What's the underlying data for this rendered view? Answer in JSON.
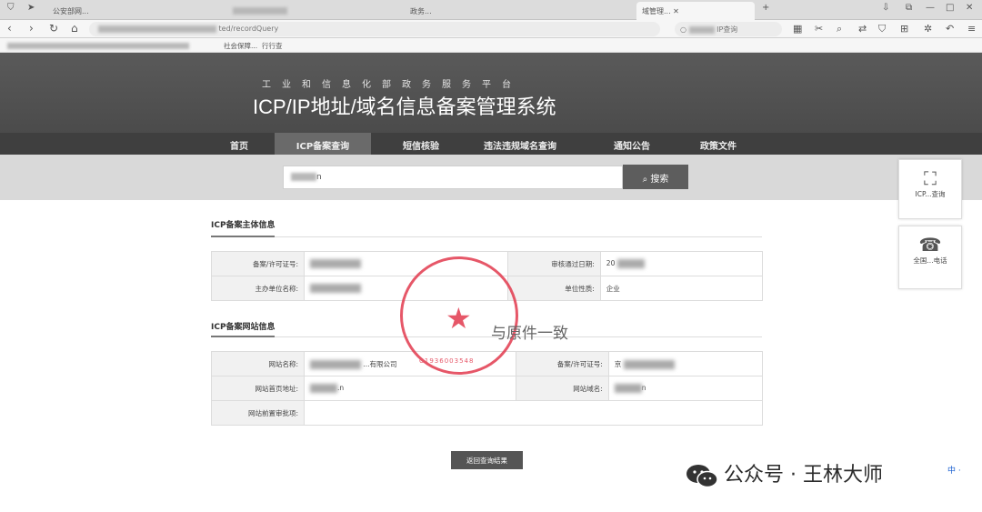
{
  "browser": {
    "tabs": [
      {
        "label": "公安部网..."
      },
      {
        "label": ""
      },
      {
        "label": "政务..."
      },
      {
        "label": "域管理..."
      }
    ],
    "url": "ted/recordQuery",
    "search_placeholder": "IP查询",
    "bookmarks": [
      "社会保障...",
      "行行查"
    ],
    "window_controls": [
      "⧉",
      "—",
      "□",
      "✕"
    ]
  },
  "site": {
    "subtitle": "工业和信息化部政务服务平台",
    "title": "ICP/IP地址/域名信息备案管理系统",
    "nav": [
      {
        "label": "首页",
        "active": false
      },
      {
        "label": "ICP备案查询",
        "active": true
      },
      {
        "label": "短信核验",
        "active": false
      },
      {
        "label": "违法违规域名查询",
        "active": false
      },
      {
        "label": "通知公告",
        "active": false
      },
      {
        "label": "政策文件",
        "active": false
      }
    ],
    "search": {
      "value": "n",
      "button": "搜索"
    }
  },
  "subject": {
    "title": "ICP备案主体信息",
    "rows": [
      {
        "label1": "备案/许可证号:",
        "value1": "",
        "label2": "审核通过日期:",
        "value2": "20"
      },
      {
        "label1": "主办单位名称:",
        "value1": "",
        "label2": "单位性质:",
        "value2": "企业"
      }
    ]
  },
  "website": {
    "title": "ICP备案网站信息",
    "rows": [
      {
        "label1": "网站名称:",
        "value1": "...有限公司",
        "label2": "备案/许可证号:",
        "value2": "京"
      },
      {
        "label1": "网站首页地址:",
        "value1": ".n",
        "label2": "网站域名:",
        "value2": "n"
      },
      {
        "label1": "网站前置审批项:",
        "value1": "",
        "label2": "",
        "value2": ""
      }
    ]
  },
  "back_button": "返回查询结果",
  "side_widgets": [
    {
      "icon": "scan-icon",
      "label": "ICP...查询"
    },
    {
      "icon": "phone-icon",
      "label": "全国...电话"
    }
  ],
  "stamp": {
    "text": "C1936003548"
  },
  "handwriting": "与原件一致",
  "watermark": {
    "text": "公众号 · 王林大师"
  },
  "ime": "中 ·"
}
